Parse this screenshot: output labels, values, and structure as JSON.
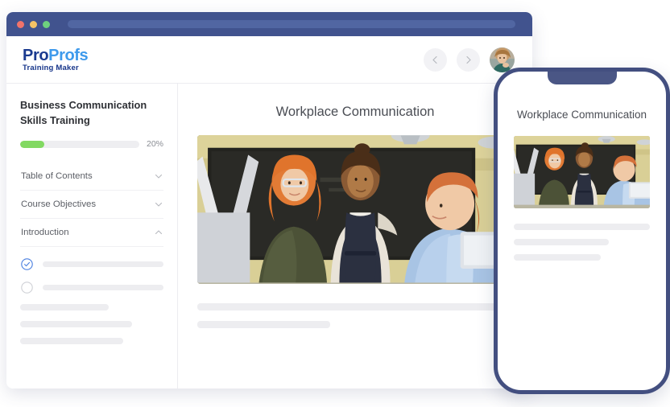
{
  "browser": {
    "traffic_lights": [
      "close-red",
      "minimize-yellow",
      "maximize-green"
    ],
    "colors": {
      "chrome": "#41538e",
      "urlbar": "#5166a2",
      "red": "#f1736a",
      "yellow": "#f5c265",
      "green": "#6ed07e"
    }
  },
  "header": {
    "logo": {
      "part1": "Pro",
      "part2": "Profs",
      "subtitle": "Training Maker",
      "color_part1": "#1a3a8f",
      "color_part2": "#3e9aec",
      "color_subtitle": "#16358a"
    },
    "prev_button_icon": "chevron-left-icon",
    "next_button_icon": "chevron-right-icon",
    "avatar_alt": "user-avatar"
  },
  "sidebar": {
    "course_title": "Business Communication Skills Training",
    "progress": {
      "percent": 20,
      "label": "20%",
      "fill_color": "#82d962",
      "track_color": "#eeeef1"
    },
    "nav_items": [
      {
        "label": "Table of Contents",
        "expanded": false,
        "icon": "chevron-down-icon"
      },
      {
        "label": "Course Objectives",
        "expanded": false,
        "icon": "chevron-up-icon"
      },
      {
        "label": "Introduction",
        "expanded": true,
        "icon": "chevron-up-icon"
      }
    ],
    "lessons": [
      {
        "state": "completed",
        "icon": "check-circle-icon",
        "bar_width": "100%"
      },
      {
        "state": "incomplete",
        "icon": "empty-circle-icon",
        "bar_width": "100%"
      }
    ],
    "placeholder_bars": [
      "62%",
      "78%",
      "72%"
    ]
  },
  "main": {
    "slide_title": "Workplace Communication",
    "image_alt": "three-colleagues-talking-in-classroom",
    "placeholder_bars": [
      "100%",
      "42%"
    ]
  },
  "phone": {
    "slide_title": "Workplace Communication",
    "image_alt": "three-colleagues-talking-in-classroom",
    "placeholder_bars": [
      "100%",
      "70%",
      "64%"
    ],
    "frame_color": "#434f80"
  }
}
